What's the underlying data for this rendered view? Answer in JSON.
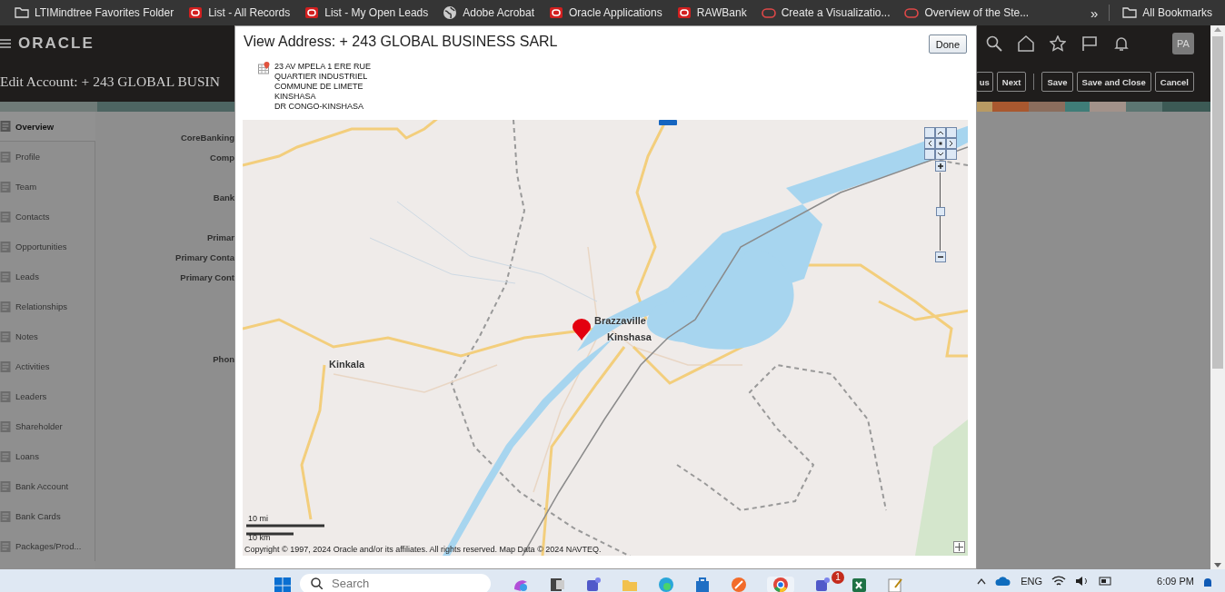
{
  "bookmarks": [
    {
      "label": "LTIMindtree Favorites Folder",
      "kind": "folder"
    },
    {
      "label": "List - All Records",
      "kind": "oracle"
    },
    {
      "label": "List - My Open Leads",
      "kind": "oracle"
    },
    {
      "label": "Adobe Acrobat",
      "kind": "globe"
    },
    {
      "label": "Oracle Applications",
      "kind": "oracle"
    },
    {
      "label": "RAWBank",
      "kind": "oracle"
    },
    {
      "label": "Create a Visualizatio...",
      "kind": "outline"
    },
    {
      "label": "Overview of the Ste...",
      "kind": "outline"
    }
  ],
  "bookmarks_overflow": "»",
  "all_bookmarks": "All Bookmarks",
  "header": {
    "brand": "ORACLE",
    "avatar": "PA"
  },
  "page": {
    "title": "Edit Account: + 243 GLOBAL BUSIN",
    "actions": [
      {
        "label": "us"
      },
      {
        "label": "Next"
      },
      {
        "label": "Save"
      },
      {
        "label": "Save and Close"
      },
      {
        "label": "Cancel"
      }
    ]
  },
  "sidebar": {
    "items": [
      {
        "label": "Overview",
        "selected": true
      },
      {
        "label": "Profile",
        "selected": false
      },
      {
        "label": "Team",
        "selected": false
      },
      {
        "label": "Contacts",
        "selected": false
      },
      {
        "label": "Opportunities",
        "selected": false
      },
      {
        "label": "Leads",
        "selected": false
      },
      {
        "label": "Relationships",
        "selected": false
      },
      {
        "label": "Notes",
        "selected": false
      },
      {
        "label": "Activities",
        "selected": false
      },
      {
        "label": "Leaders",
        "selected": false
      },
      {
        "label": "Shareholder",
        "selected": false
      },
      {
        "label": "Loans",
        "selected": false
      },
      {
        "label": "Bank Account",
        "selected": false
      },
      {
        "label": "Bank Cards",
        "selected": false
      },
      {
        "label": "Packages/Prod...",
        "selected": false
      }
    ]
  },
  "form": {
    "groups": [
      [
        "CoreBanking",
        "Comp"
      ],
      [
        "Bank"
      ],
      [
        "Primar",
        "Primary Conta",
        "Primary Cont"
      ],
      [
        "Phon"
      ]
    ]
  },
  "dialog": {
    "title": "View Address: + 243 GLOBAL BUSINESS SARL",
    "done": "Done",
    "address_lines": [
      "23 AV MPELA 1 ERE RUE",
      "QUARTIER INDUSTRIEL",
      "COMMUNE DE LIMETE",
      "KINSHASA",
      "DR CONGO-KINSHASA"
    ],
    "map": {
      "places": [
        {
          "name": "Brazzaville"
        },
        {
          "name": "Kinshasa"
        },
        {
          "name": "Kinkala"
        }
      ],
      "scale": [
        "10 mi",
        "10 km"
      ],
      "zoom": {
        "level": 0.5
      },
      "copyright": "Copyright © 1997, 2024 Oracle and/or its affiliates. All rights reserved. Map Data © 2024 NAVTEQ."
    }
  },
  "taskbar": {
    "search_placeholder": "Search",
    "badge": "1",
    "language": "ENG",
    "time": "6:09 PM"
  }
}
